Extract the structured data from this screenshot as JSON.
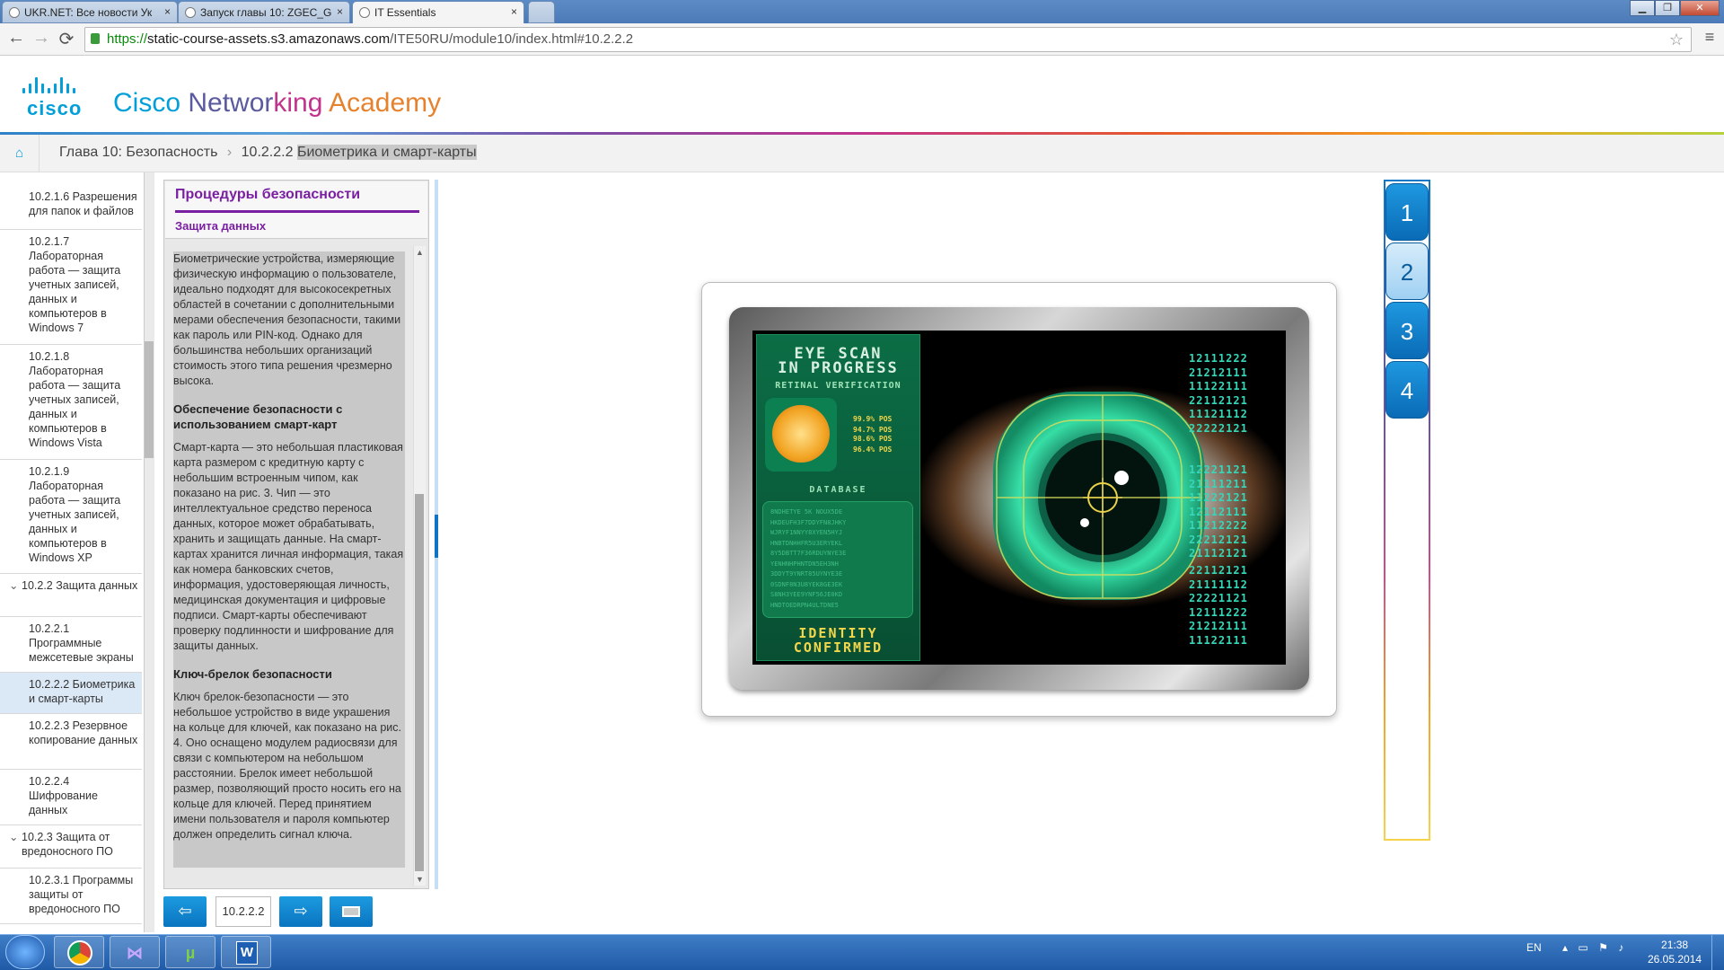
{
  "browser": {
    "tabs": [
      {
        "title": "UKR.NET: Все новости Ук"
      },
      {
        "title": "Запуск главы 10: ZGEC_G"
      },
      {
        "title": "IT Essentials"
      }
    ],
    "url_scheme": "https://",
    "url_host": "static-course-assets.s3.amazonaws.com",
    "url_path": "/ITE50RU/module10/index.html#10.2.2.2",
    "close_glyph": "×"
  },
  "header": {
    "logo_text": "cisco",
    "brand_parts": [
      {
        "text": "Cisco ",
        "color": "#049fd9"
      },
      {
        "text": "Networ",
        "color": "#5a5a9e"
      },
      {
        "text": "king ",
        "color": "#c2338d"
      },
      {
        "text": "Academy",
        "color": "#e6822d"
      }
    ]
  },
  "breadcrumb": {
    "chapter": "Глава 10: Безопасность",
    "separator": "›",
    "current_num": "10.2.2.2",
    "current_title": "Биометрика и смарт-карты"
  },
  "toc": {
    "items": [
      {
        "label": "10.2.1.6 Разрешения для папок и файлов"
      },
      {
        "label": "10.2.1.7 Лабораторная работа — защита учетных записей, данных и компьютеров в Windows 7"
      },
      {
        "label": "10.2.1.8 Лабораторная работа — защита учетных записей, данных и компьютеров в Windows Vista"
      },
      {
        "label": "10.2.1.9 Лабораторная работа — защита учетных записей, данных и компьютеров в Windows XP"
      },
      {
        "label": "10.2.2 Защита данных"
      },
      {
        "label": "10.2.2.1 Программные межсетевые экраны"
      },
      {
        "label": "10.2.2.2 Биометрика и смарт-карты"
      },
      {
        "label": "10.2.2.3 Резервное копирование данных"
      },
      {
        "label": "10.2.2.4 Шифрование данных"
      },
      {
        "label": "10.2.3 Защита от вредоносного ПО"
      },
      {
        "label": "10.2.3.1 Программы защиты от вредоносного ПО"
      }
    ]
  },
  "content": {
    "title": "Процедуры безопасности",
    "subtitle": "Защита данных",
    "p1": "Биометрические устройства, измеряющие физическую информацию о пользователе, идеально подходят для высокосекретных областей в сочетании с дополнительными мерами обеспечения безопасности, такими как пароль или PIN-код. Однако для большинства небольших организаций стоимость этого типа решения чрезмерно высока.",
    "h2": "Обеспечение безопасности с использованием смарт-карт",
    "p2": "Смарт-карта — это небольшая пластиковая карта размером с кредитную карту с небольшим встроенным чипом, как показано на рис. 3. Чип — это интеллектуальное средство переноса данных, которое может обрабатывать, хранить и защищать данные. На смарт-картах хранится личная информация, такая как номера банковских счетов, информация, удостоверяющая личность, медицинская документация и цифровые подписи. Смарт-карты обеспечивают проверку подлинности и шифрование для защиты данных.",
    "h3": "Ключ-брелок безопасности",
    "p3": "Ключ брелок-безопасности — это небольшое устройство в виде украшения на кольце для ключей, как показано на рис. 4. Оно оснащено модулем радиосвязи для связи с компьютером на небольшом расстоянии. Брелок имеет небольшой размер, позволяющий просто носить его на кольце для ключей. Перед принятием имени пользователя и пароля компьютер должен определить сигнал ключа."
  },
  "nav": {
    "page_number": "10.2.2.2",
    "prev_glyph": "⇦",
    "next_glyph": "⇨"
  },
  "media": {
    "scan_title_1": "EYE SCAN",
    "scan_title_2": "IN PROGRESS",
    "retinal": "RETINAL VERIFICATION",
    "stats": [
      "99.9% POS",
      "94.7% POS",
      "98.6% POS",
      "96.4% POS"
    ],
    "database": "DATABASE",
    "identity_1": "IDENTITY",
    "identity_2": "CONFIRMED",
    "db_lines": [
      "8NDHETYE 5K NOUX5DE",
      "HKDEUFH3F7DDYFN8JHKY",
      "WJRYF1NNYY8XYEN5HYJ",
      "HNBTDNHHFR5U3ERYEKL",
      "8Y5DBTT7F36RDUYNYE3E",
      "YENHNHPHNTDN5EH3NH",
      "3DDYT9YNRT85UYNYE3E",
      "0SDNF8N3U8YEK8GE3EK",
      "S8NH3YEE9YNF56JE0KD",
      "HNDTOEDRPN4ULTDNE5"
    ],
    "codes_block_1": [
      "12111222",
      "21212111",
      "11122111",
      "22112121",
      "11121112",
      "22222121"
    ],
    "codes_block_2": [
      "12221121",
      "21111211",
      "11222121",
      "12112111",
      "11212222",
      "22212121",
      "21112121"
    ],
    "codes_block_3": [
      "22112121",
      "21111112",
      "22221121",
      "12111222",
      "21212111",
      "11122111"
    ]
  },
  "figure_tabs": [
    "1",
    "2",
    "3",
    "4"
  ],
  "figure_tabs_current": "2",
  "taskbar": {
    "lang": "EN",
    "time": "21:38",
    "date": "26.05.2014"
  },
  "colors": {
    "accent": "#049fd9",
    "purple": "#7a1fa2",
    "button_blue": "#0a74c0"
  }
}
